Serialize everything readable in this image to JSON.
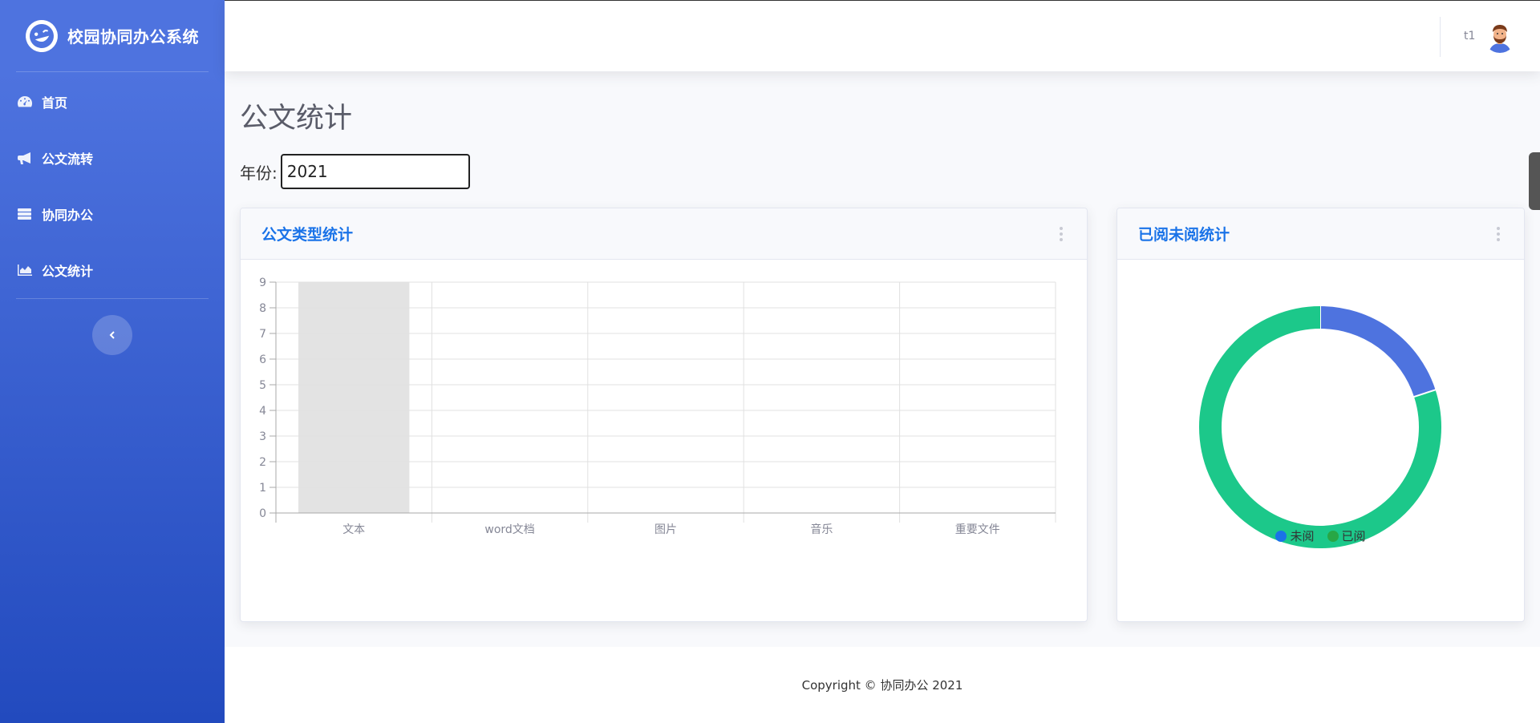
{
  "brand": {
    "title": "校园协同办公系统",
    "icon": "laugh-wink-icon"
  },
  "sidebar": {
    "items": [
      {
        "label": "首页",
        "icon": "tachometer-icon"
      },
      {
        "label": "公文流转",
        "icon": "bullhorn-icon"
      },
      {
        "label": "协同办公",
        "icon": "server-icon"
      },
      {
        "label": "公文统计",
        "icon": "chart-area-icon"
      }
    ],
    "toggle_icon": "chevron-left-icon"
  },
  "topbar": {
    "user_name": "t1",
    "avatar_icon": "user-avatar-icon"
  },
  "page": {
    "title": "公文统计"
  },
  "filter": {
    "label": "年份:",
    "value": "2021"
  },
  "bar_card": {
    "title": "公文类型统计"
  },
  "pie_card": {
    "title": "已阅未阅统计"
  },
  "colors": {
    "primary": "#4e73df",
    "unread": "#4e73df",
    "read": "#1cc88a",
    "title_blue": "#1a73e8"
  },
  "chart_data": [
    {
      "type": "bar",
      "categories": [
        "文本",
        "word文档",
        "图片",
        "音乐",
        "重要文件"
      ],
      "values": [
        0,
        0,
        0,
        0,
        0
      ],
      "ylim": [
        0,
        9
      ],
      "yticks": [
        "0",
        "1",
        "2",
        "3",
        "4",
        "5",
        "6",
        "7",
        "8",
        "9"
      ],
      "hovered_category": "文本",
      "grid": true,
      "title": "",
      "xlabel": "",
      "ylabel": ""
    },
    {
      "type": "pie",
      "variant": "doughnut",
      "labels": [
        "未阅",
        "已阅"
      ],
      "values": [
        1,
        4
      ],
      "colors": [
        "#4e73df",
        "#1cc88a"
      ],
      "legend": [
        {
          "label": "未阅",
          "color": "#1a73e8"
        },
        {
          "label": "已阅",
          "color": "#28a745"
        }
      ],
      "legend_position": "bottom"
    }
  ],
  "footer": {
    "text": "Copyright © 协同办公 2021"
  }
}
